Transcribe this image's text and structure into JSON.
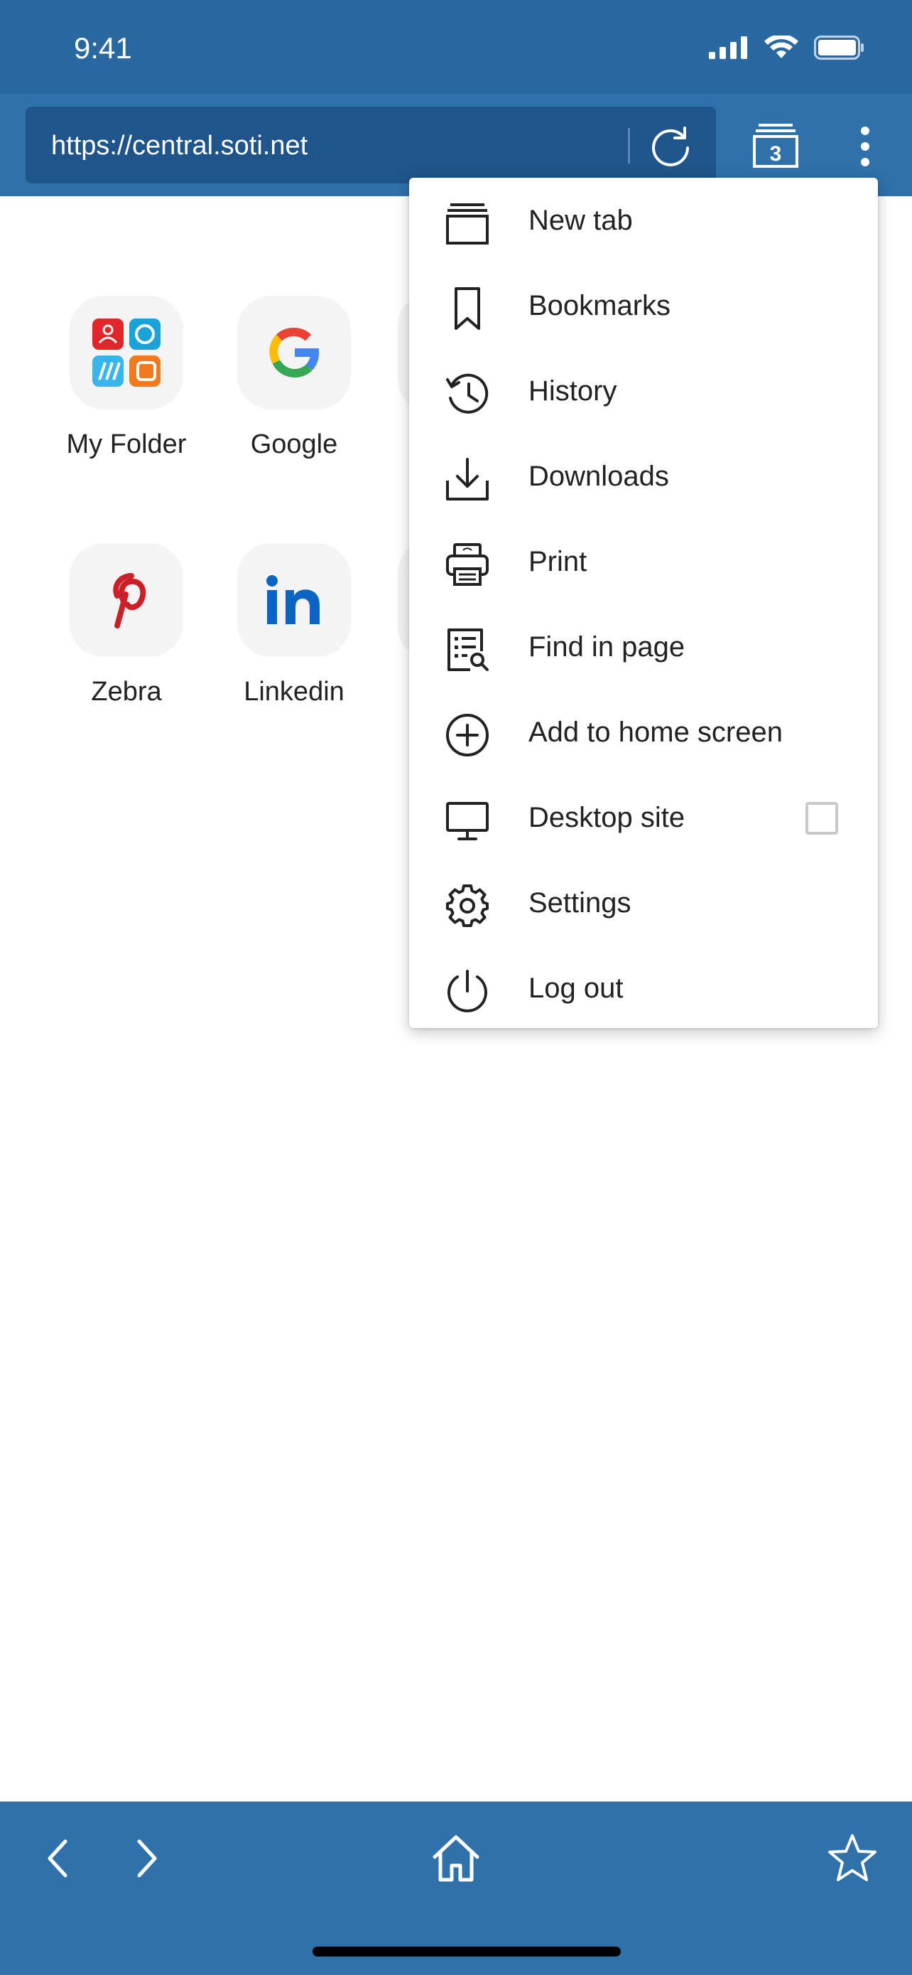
{
  "status_bar": {
    "time": "9:41"
  },
  "browser": {
    "url": "https://central.soti.net",
    "tab_count": "3",
    "icons": {
      "reload": "reload-icon",
      "tabs": "tabs-icon",
      "more": "more-vertical-icon"
    }
  },
  "speed_dial": [
    {
      "label": "My Folder",
      "icon": "folder-apps-icon"
    },
    {
      "label": "Google",
      "icon": "google-icon"
    },
    {
      "label": "Zebra",
      "icon": "pinterest-icon"
    },
    {
      "label": "Linkedin",
      "icon": "linkedin-icon"
    }
  ],
  "menu": {
    "items": [
      {
        "label": "New tab",
        "icon": "new-tab-icon"
      },
      {
        "label": "Bookmarks",
        "icon": "bookmark-icon"
      },
      {
        "label": "History",
        "icon": "history-icon"
      },
      {
        "label": "Downloads",
        "icon": "download-icon"
      },
      {
        "label": "Print",
        "icon": "printer-icon"
      },
      {
        "label": "Find in page",
        "icon": "find-in-page-icon"
      },
      {
        "label": "Add to home screen",
        "icon": "add-circle-icon"
      },
      {
        "label": "Desktop site",
        "icon": "desktop-icon",
        "checked": false
      },
      {
        "label": "Settings",
        "icon": "gear-icon"
      },
      {
        "label": "Log out",
        "icon": "power-icon"
      }
    ]
  },
  "bottom_bar": {
    "icons": [
      "back-icon",
      "forward-icon",
      "home-icon",
      "star-icon"
    ]
  },
  "colors": {
    "toolbar": "#2f71ab",
    "status": "#2a68a1",
    "url_field": "#1f558a"
  }
}
